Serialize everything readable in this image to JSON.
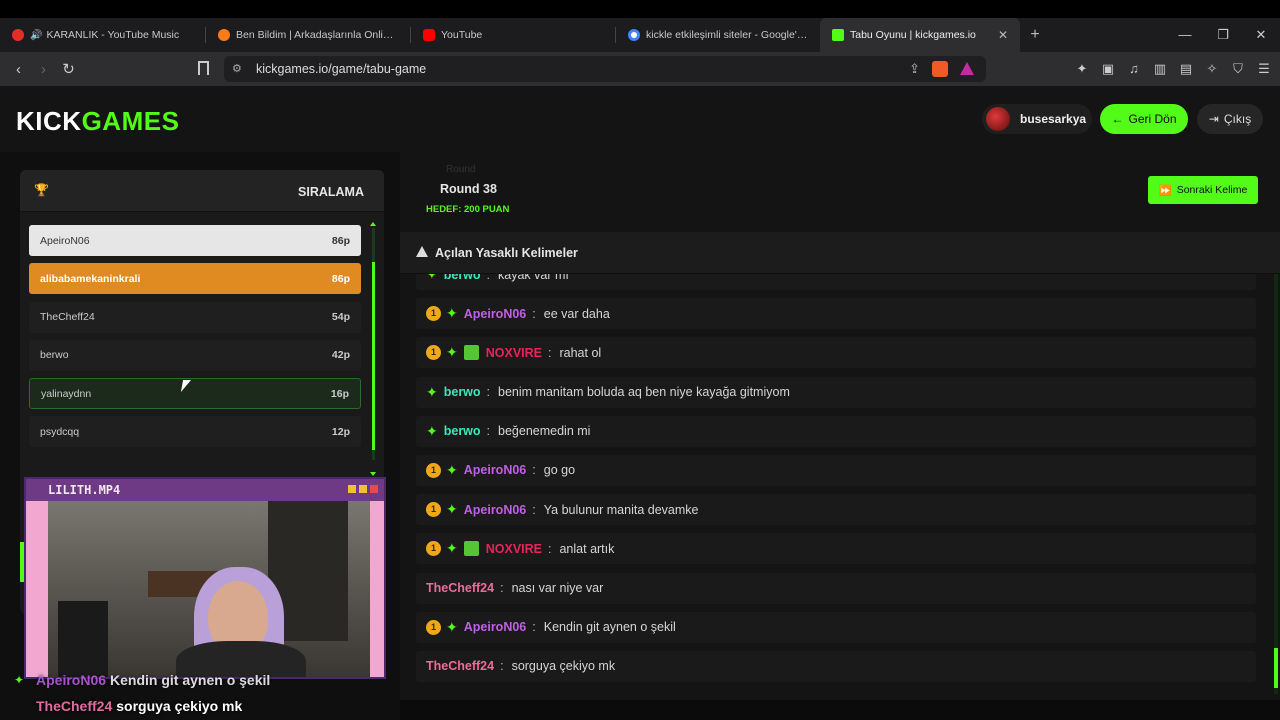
{
  "browser": {
    "tabs": [
      {
        "label": "KARANLIK - YouTube Music",
        "color": "#e52d27"
      },
      {
        "label": "Ben Bildim | Arkadaşlarınla Online Bil",
        "color": "#ff7a1a"
      },
      {
        "label": "YouTube",
        "color": "#ff0000"
      },
      {
        "label": "kickle etkileşimli siteler - Google'da A",
        "color": "#4285f4"
      },
      {
        "label": "Tabu Oyunu | kickgames.io",
        "color": "#53fc18"
      }
    ],
    "url": "kickgames.io/game/tabu-game"
  },
  "header": {
    "logo_kick": "KICK",
    "logo_games": "GAMES",
    "username": "busesarkya",
    "back_label": "Geri Dön",
    "logout_label": "Çıkış"
  },
  "leaderboard": {
    "title": "SIRALAMA",
    "rows": [
      {
        "name": "ApeiroN06",
        "points": "86p"
      },
      {
        "name": "alibabamekaninkrali",
        "points": "86p"
      },
      {
        "name": "TheCheff24",
        "points": "54p"
      },
      {
        "name": "berwo",
        "points": "42p"
      },
      {
        "name": "yalinaydnn",
        "points": "16p"
      },
      {
        "name": "psydcqq",
        "points": "12p"
      }
    ]
  },
  "webcam": {
    "title": "LILITH.MP4"
  },
  "overlay": {
    "msg1_user": "ApeiroN06",
    "msg1_text": "Kendin git aynen o şekil",
    "msg2_user": "TheCheff24",
    "msg2_text": "sorguya çekiyo mk"
  },
  "game": {
    "faded_label": "Round",
    "round": "Round 38",
    "target": "HEDEF: 200 PUAN",
    "next_label": "Sonraki Kelime",
    "forbidden_label": "Açılan Yasaklı Kelimeler"
  },
  "chat": [
    {
      "user": "berwo",
      "text": "kayak var mı",
      "color": "#3ee8b8",
      "badges": [
        "star"
      ]
    },
    {
      "user": "ApeiroN06",
      "text": "ee var daha",
      "color": "#c060e8",
      "badges": [
        "1",
        "star"
      ]
    },
    {
      "user": "NOXVIRE",
      "text": "rahat ol",
      "color": "#e8245a",
      "badges": [
        "1",
        "star",
        "gift"
      ]
    },
    {
      "user": "berwo",
      "text": "benim manitam boluda aq ben niye kayağa gitmiyom",
      "color": "#3ee8b8",
      "badges": [
        "star"
      ]
    },
    {
      "user": "berwo",
      "text": "beğenemedin mi",
      "color": "#3ee8b8",
      "badges": [
        "star"
      ]
    },
    {
      "user": "ApeiroN06",
      "text": "go go",
      "color": "#c060e8",
      "badges": [
        "1",
        "star"
      ]
    },
    {
      "user": "ApeiroN06",
      "text": "Ya bulunur manita devamke",
      "color": "#c060e8",
      "badges": [
        "1",
        "star"
      ]
    },
    {
      "user": "NOXVIRE",
      "text": "anlat artık",
      "color": "#e8245a",
      "badges": [
        "1",
        "star",
        "gift"
      ]
    },
    {
      "user": "TheCheff24",
      "text": "nası var niye var",
      "color": "#f06a9a",
      "badges": []
    },
    {
      "user": "ApeiroN06",
      "text": "Kendin git aynen o şekil",
      "color": "#c060e8",
      "badges": [
        "1",
        "star"
      ]
    },
    {
      "user": "TheCheff24",
      "text": "sorguya çekiyo mk",
      "color": "#f06a9a",
      "badges": []
    }
  ]
}
